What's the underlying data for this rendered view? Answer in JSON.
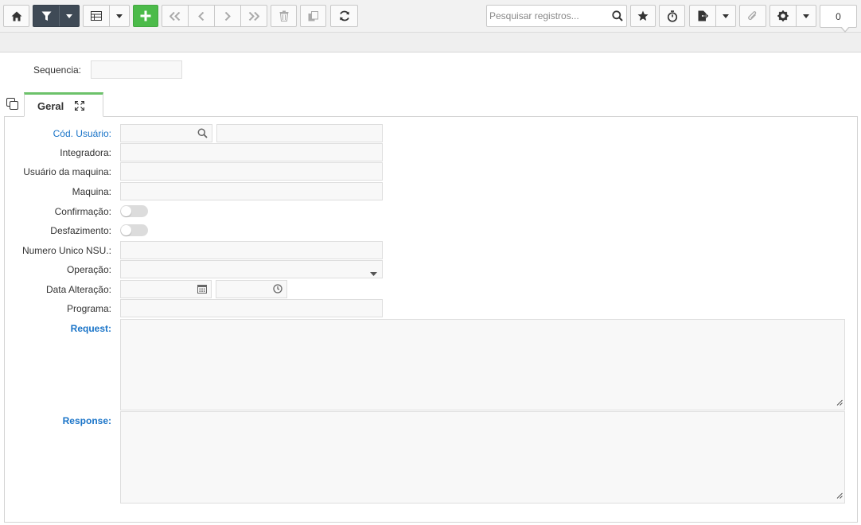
{
  "toolbar": {
    "search_placeholder": "Pesquisar registros...",
    "record_count": "0"
  },
  "header": {
    "sequencia_label": "Sequencia:",
    "sequencia_value": ""
  },
  "tab": {
    "label": "Geral"
  },
  "form": {
    "cod_usuario_label": "Cód. Usuário:",
    "integradora_label": "Integradora:",
    "usuario_maquina_label": "Usuário da maquina:",
    "maquina_label": "Maquina:",
    "confirmacao_label": "Confirmação:",
    "desfazimento_label": "Desfazimento:",
    "nsu_label": "Numero Unico NSU.:",
    "operacao_label": "Operação:",
    "data_alteracao_label": "Data Alteração:",
    "programa_label": "Programa:",
    "request_label": "Request:",
    "response_label": "Response:"
  },
  "colors": {
    "accent_green": "#4cbb4a",
    "filter_dark": "#3f4a56",
    "label_blue": "#1a74c8",
    "tab_green": "#6cc26a"
  },
  "icons": [
    "home-icon",
    "filter-icon",
    "grid-icon",
    "plus-icon",
    "first-icon",
    "prev-icon",
    "next-icon",
    "last-icon",
    "trash-icon",
    "copy-icon",
    "refresh-icon",
    "search-icon",
    "star-icon",
    "stopwatch-icon",
    "export-icon",
    "paperclip-icon",
    "gear-icon",
    "calendar-icon",
    "clock-icon",
    "expand-icon",
    "clone-icon"
  ]
}
